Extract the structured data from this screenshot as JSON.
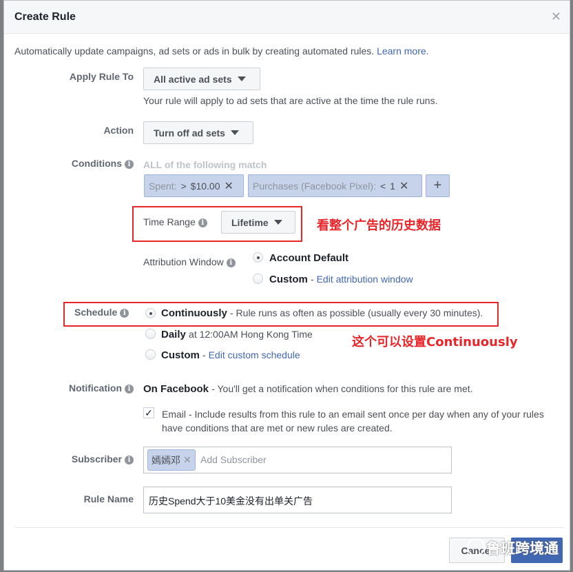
{
  "dialog": {
    "title": "Create Rule",
    "close_icon": "close-icon"
  },
  "intro": {
    "text": "Automatically update campaigns, ad sets or ads in bulk by creating automated rules.",
    "link": "Learn more."
  },
  "apply_rule": {
    "label": "Apply Rule To",
    "value": "All active ad sets",
    "help": "Your rule will apply to ad sets that are active at the time the rule runs."
  },
  "action": {
    "label": "Action",
    "value": "Turn off ad sets"
  },
  "conditions": {
    "label": "Conditions",
    "match_text": "ALL of the following match",
    "items": [
      {
        "field": "Spent:",
        "operator": ">",
        "value": "$10.00"
      },
      {
        "field": "Purchases (Facebook Pixel):",
        "operator": "<",
        "value": "1"
      }
    ],
    "add_label": "+"
  },
  "time_range": {
    "label": "Time Range",
    "value": "Lifetime"
  },
  "attribution": {
    "label": "Attribution Window",
    "options": [
      {
        "label": "Account Default",
        "selected": true
      },
      {
        "label": "Custom",
        "link": "Edit attribution window",
        "selected": false
      }
    ]
  },
  "schedule": {
    "label": "Schedule",
    "options": [
      {
        "label": "Continuously",
        "desc": "- Rule runs as often as possible (usually every 30 minutes).",
        "selected": true
      },
      {
        "label": "Daily",
        "desc": "at 12:00AM Hong Kong Time",
        "selected": false
      },
      {
        "label": "Custom",
        "link": "Edit custom schedule",
        "selected": false
      }
    ]
  },
  "notification": {
    "label": "Notification",
    "title": "On Facebook",
    "desc": "- You'll get a notification when conditions for this rule are met.",
    "email_checked": true,
    "email_label": "Email",
    "email_desc": "- Include results from this rule to an email sent once per day when any of your rules",
    "email_desc2": "have conditions that are met or new rules are created."
  },
  "subscriber": {
    "label": "Subscriber",
    "chip": "嫣嫣邓",
    "placeholder": "Add Subscriber"
  },
  "rule_name": {
    "label": "Rule Name",
    "value": "历史Spend大于10美金没有出单关广告"
  },
  "footer": {
    "cancel": "Cancel",
    "create": ""
  },
  "annotations": {
    "time_range": "看整个广告的历史数据",
    "schedule": "这个可以设置Continuously"
  },
  "watermark": "鲁班跨境通",
  "colors": {
    "annotation": "#e8262a",
    "primary": "#4267b2",
    "link": "#4267b2"
  }
}
